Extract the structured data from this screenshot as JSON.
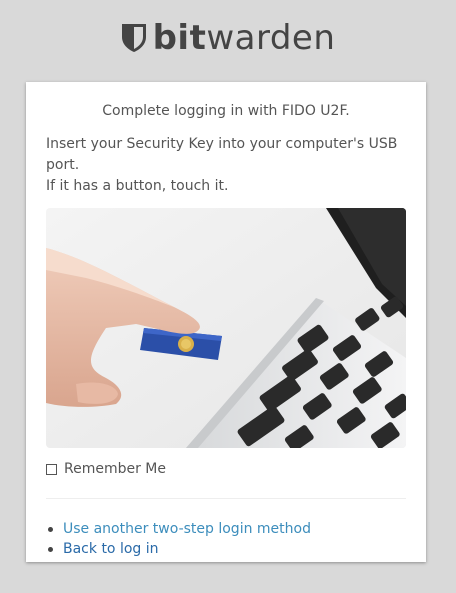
{
  "brand": {
    "name_bold": "bit",
    "name_regular": "warden",
    "logo_icon": "shield-icon"
  },
  "card": {
    "title": "Complete logging in with FIDO U2F.",
    "instructions_line1": "Insert your Security Key into your computer's USB port.",
    "instructions_line2": "If it has a button, touch it.",
    "image": "security-key-in-laptop-photo",
    "remember_label": "Remember Me",
    "remember_checked": false
  },
  "links": {
    "other_method": "Use another two-step login method",
    "back": "Back to log in"
  },
  "colors": {
    "background": "#d9d9d9",
    "link": "#3c8dbc",
    "text": "#555555"
  }
}
